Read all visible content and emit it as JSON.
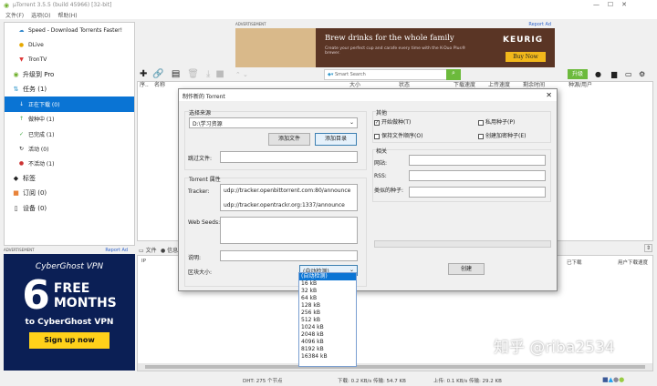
{
  "window": {
    "title": "µTorrent 3.5.5  (build 45966) [32-bit]",
    "menu": [
      "文件(F)",
      "选项(O)",
      "帮助(H)"
    ]
  },
  "sidebar": {
    "items": [
      {
        "label": "Speed - Download Torrents Faster!",
        "icon": "speed-icon"
      },
      {
        "label": "DLive",
        "icon": "dlive-icon"
      },
      {
        "label": "TronTV",
        "icon": "trontv-icon"
      },
      {
        "label": "升级到 Pro",
        "icon": "utorrent-icon"
      },
      {
        "label": "任务 (1)",
        "icon": "tasks-icon"
      },
      {
        "label": "正在下载 (0)",
        "icon": "download-icon",
        "selected": true
      },
      {
        "label": "做种中 (1)",
        "icon": "seed-icon"
      },
      {
        "label": "已完成 (1)",
        "icon": "check-icon"
      },
      {
        "label": "活动 (0)",
        "icon": "refresh-icon"
      },
      {
        "label": "不活动 (1)",
        "icon": "inactive-icon"
      },
      {
        "label": "标签",
        "icon": "tag-icon"
      },
      {
        "label": "订阅 (0)",
        "icon": "rss-icon"
      },
      {
        "label": "设备 (0)",
        "icon": "device-icon"
      }
    ]
  },
  "ad_left": {
    "header": "ADVERTISEMENT",
    "report": "Report Ad",
    "brand": "CyberGhost VPN",
    "big": "6",
    "line1": "FREE",
    "line2": "MONTHS",
    "line3": "to CyberGhost VPN",
    "cta": "Sign up now"
  },
  "ad_top": {
    "header": "ADVERTISEMENT",
    "report": "Report Ad",
    "headline": "Brew drinks for the whole family",
    "body": "Create your perfect cup and carafe every time with the K-Duo Plus® brewer.",
    "brand": "KEURIG",
    "cta": "Buy Now"
  },
  "toolbar": {
    "search_placeholder": "Smart Search",
    "upgrade": "升级"
  },
  "columns": [
    "序..",
    "名称",
    "大小",
    "状态",
    "下载速度",
    "上传速度",
    "剩余时间",
    "种源/用户"
  ],
  "bottom": {
    "tabs": [
      "文件",
      "信息"
    ],
    "columns": [
      "IP",
      "已下载",
      "用户下载速度"
    ]
  },
  "dialog": {
    "title": "制作新的 Torrent",
    "source_group": "选择来源",
    "source_value": "D:\\学习资源",
    "add_file": "添加文件",
    "add_dir": "添加目录",
    "skip_label": "跳过文件:",
    "props_group": "Torrent 属性",
    "tracker_label": "Tracker:",
    "trackers": [
      "udp://tracker.openbittorrent.com:80/announce",
      "udp://tracker.opentrackr.org:1337/announce"
    ],
    "webseeds_label": "Web Seeds:",
    "comment_label": "说明:",
    "piece_label": "区块大小:",
    "piece_value": "(自动检测)",
    "other_group": "其他",
    "options": [
      {
        "label": "开始做种(T)",
        "checked": true
      },
      {
        "label": "私用种子(P)",
        "checked": false
      },
      {
        "label": "保持文件顺序(O)",
        "checked": false
      },
      {
        "label": "创建加密种子(E)",
        "checked": false
      }
    ],
    "related_group": "相关",
    "website_label": "网站:",
    "rss_label": "RSS:",
    "similar_label": "类似的种子:",
    "create": "创建",
    "piece_options": [
      "(自动检测)",
      "16 kB",
      "32 kB",
      "64 kB",
      "128 kB",
      "256 kB",
      "512 kB",
      "1024 kB",
      "2048 kB",
      "4096 kB",
      "8192 kB",
      "16384 kB"
    ]
  },
  "status": {
    "dht": "DHT: 275 个节点",
    "down": "下载: 0.2 KB/s 传输: 54.7 KB",
    "up": "上传: 0.1 KB/s 传输: 29.2 KB"
  },
  "watermark": "知乎 @riba2534"
}
